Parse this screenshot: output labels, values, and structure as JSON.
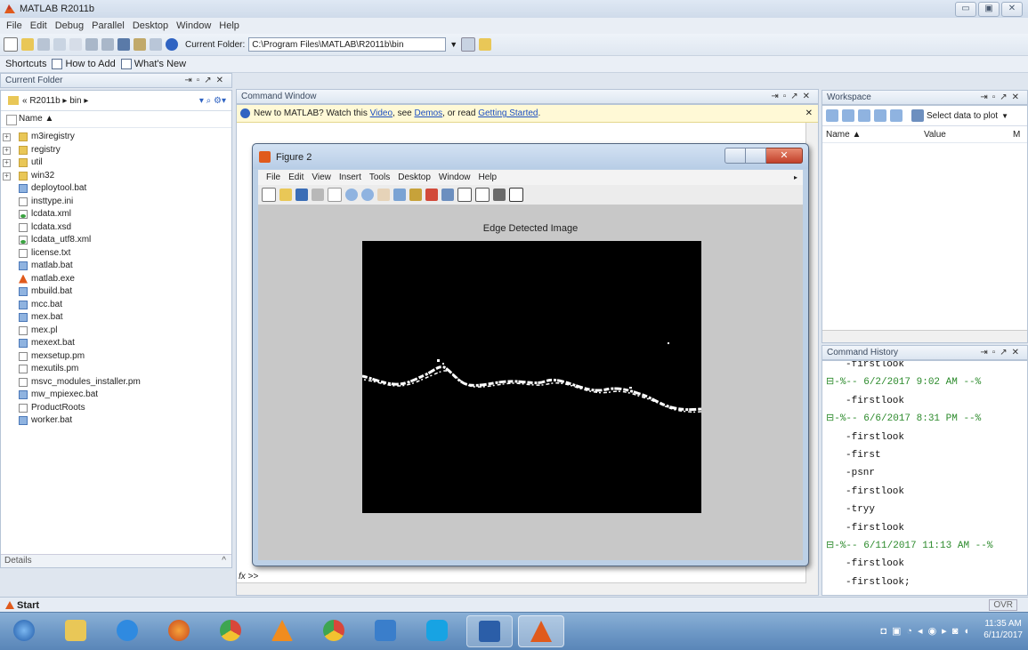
{
  "window": {
    "title": "MATLAB R2011b",
    "minimize": "▭",
    "maximize": "▣",
    "close": "✕"
  },
  "menu": [
    "File",
    "Edit",
    "Debug",
    "Parallel",
    "Desktop",
    "Window",
    "Help"
  ],
  "toolbar": {
    "current_folder_label": "Current Folder:",
    "current_folder_value": "C:\\Program Files\\MATLAB\\R2011b\\bin"
  },
  "shortcuts": {
    "shortcuts": "Shortcuts",
    "how_to_add": "How to Add",
    "whats_new": "What's New"
  },
  "current_folder": {
    "header": "Current Folder",
    "path": "« R2011b ▸ bin ▸",
    "name_col": "Name ▲",
    "items": [
      {
        "name": "m3iregistry",
        "type": "folder"
      },
      {
        "name": "registry",
        "type": "folder"
      },
      {
        "name": "util",
        "type": "folder"
      },
      {
        "name": "win32",
        "type": "folder"
      },
      {
        "name": "deploytool.bat",
        "type": "bat"
      },
      {
        "name": "insttype.ini",
        "type": "txt"
      },
      {
        "name": "lcdata.xml",
        "type": "xml"
      },
      {
        "name": "lcdata.xsd",
        "type": "txt"
      },
      {
        "name": "lcdata_utf8.xml",
        "type": "xml"
      },
      {
        "name": "license.txt",
        "type": "txt"
      },
      {
        "name": "matlab.bat",
        "type": "bat"
      },
      {
        "name": "matlab.exe",
        "type": "exe"
      },
      {
        "name": "mbuild.bat",
        "type": "bat"
      },
      {
        "name": "mcc.bat",
        "type": "bat"
      },
      {
        "name": "mex.bat",
        "type": "bat"
      },
      {
        "name": "mex.pl",
        "type": "txt"
      },
      {
        "name": "mexext.bat",
        "type": "bat"
      },
      {
        "name": "mexsetup.pm",
        "type": "txt"
      },
      {
        "name": "mexutils.pm",
        "type": "txt"
      },
      {
        "name": "msvc_modules_installer.pm",
        "type": "txt"
      },
      {
        "name": "mw_mpiexec.bat",
        "type": "bat"
      },
      {
        "name": "ProductRoots",
        "type": "txt"
      },
      {
        "name": "worker.bat",
        "type": "bat"
      }
    ],
    "details": "Details"
  },
  "command_window": {
    "header": "Command Window",
    "notice_prefix": "New to MATLAB? Watch this",
    "video": "Video",
    "see": ", see",
    "demos": "Demos",
    "or_read": ", or read",
    "getting_started": "Getting Started",
    "period": ".",
    "prompt": "fx >>"
  },
  "figure": {
    "title": "Figure 2",
    "menu": [
      "File",
      "Edit",
      "View",
      "Insert",
      "Tools",
      "Desktop",
      "Window",
      "Help"
    ],
    "axes_title": "Edge Detected Image"
  },
  "workspace": {
    "header": "Workspace",
    "select_data": "Select data to plot",
    "col_name": "Name ▲",
    "col_value": "Value",
    "col_m": "M"
  },
  "history": {
    "header": "Command History",
    "lines": [
      {
        "text": "firstlook",
        "section": false
      },
      {
        "text": "⊟-%-- 6/2/2017 9:02 AM --%",
        "section": true
      },
      {
        "text": "firstlook",
        "section": false
      },
      {
        "text": "⊟-%-- 6/6/2017 8:31 PM --%",
        "section": true
      },
      {
        "text": "firstlook",
        "section": false
      },
      {
        "text": "first",
        "section": false
      },
      {
        "text": "psnr",
        "section": false
      },
      {
        "text": "firstlook",
        "section": false
      },
      {
        "text": "tryy",
        "section": false
      },
      {
        "text": "firstlook",
        "section": false
      },
      {
        "text": "⊟-%-- 6/11/2017 11:13 AM --%",
        "section": true
      },
      {
        "text": "firstlook",
        "section": false
      },
      {
        "text": "firstlook;",
        "section": false
      },
      {
        "text": "firstlook",
        "section": false
      }
    ]
  },
  "status": {
    "start": "Start",
    "ovr": "OVR"
  },
  "taskbar": {
    "time": "11:35 AM",
    "date": "6/11/2017"
  },
  "colors": {
    "accent": "#1a4ec2",
    "history_section": "#2b8a2b",
    "matlab_orange": "#e05a1c"
  }
}
